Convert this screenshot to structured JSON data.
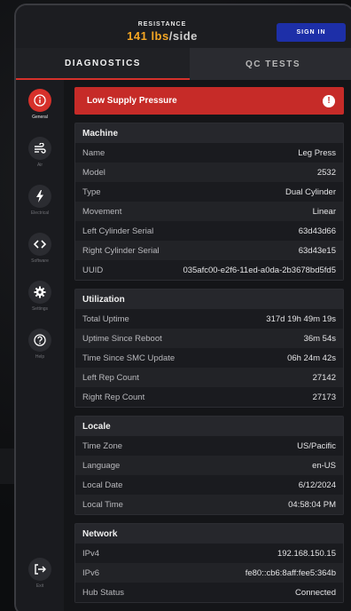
{
  "header": {
    "resistance_label": "RESISTANCE",
    "resistance_value": "141 lbs",
    "resistance_unit": "/side",
    "sign_in_label": "SIGN IN"
  },
  "tabs": [
    {
      "label": "DIAGNOSTICS",
      "active": true
    },
    {
      "label": "QC TESTS",
      "active": false
    }
  ],
  "sidebar": {
    "items": [
      {
        "label": "General",
        "icon": "info-icon",
        "active": true
      },
      {
        "label": "Air",
        "icon": "air-icon",
        "active": false
      },
      {
        "label": "Electrical",
        "icon": "bolt-icon",
        "active": false
      },
      {
        "label": "Software",
        "icon": "code-icon",
        "active": false
      },
      {
        "label": "Settings",
        "icon": "gear-icon",
        "active": false
      },
      {
        "label": "Help",
        "icon": "help-icon",
        "active": false
      }
    ],
    "exit": {
      "label": "Exit",
      "icon": "exit-icon"
    }
  },
  "alert": {
    "text": "Low Supply Pressure",
    "icon": "exclamation-icon",
    "color": "#c62b28"
  },
  "sections": {
    "machine": {
      "title": "Machine",
      "rows": [
        {
          "key": "Name",
          "value": "Leg Press"
        },
        {
          "key": "Model",
          "value": "2532"
        },
        {
          "key": "Type",
          "value": "Dual Cylinder"
        },
        {
          "key": "Movement",
          "value": "Linear"
        },
        {
          "key": "Left Cylinder Serial",
          "value": "63d43d66"
        },
        {
          "key": "Right Cylinder Serial",
          "value": "63d43e15"
        },
        {
          "key": "UUID",
          "value": "035afc00-e2f6-11ed-a0da-2b3678bd5fd5"
        }
      ]
    },
    "utilization": {
      "title": "Utilization",
      "rows": [
        {
          "key": "Total Uptime",
          "value": "317d 19h 49m 19s"
        },
        {
          "key": "Uptime Since Reboot",
          "value": "36m 54s"
        },
        {
          "key": "Time Since SMC Update",
          "value": "06h 24m 42s"
        },
        {
          "key": "Left Rep Count",
          "value": "27142"
        },
        {
          "key": "Right Rep Count",
          "value": "27173"
        }
      ]
    },
    "locale": {
      "title": "Locale",
      "rows": [
        {
          "key": "Time Zone",
          "value": "US/Pacific"
        },
        {
          "key": "Language",
          "value": "en-US"
        },
        {
          "key": "Local Date",
          "value": "6/12/2024"
        },
        {
          "key": "Local Time",
          "value": "04:58:04 PM"
        }
      ]
    },
    "network": {
      "title": "Network",
      "rows": [
        {
          "key": "IPv4",
          "value": "192.168.150.15"
        },
        {
          "key": "IPv6",
          "value": "fe80::cb6:8aff:fee5:364b"
        },
        {
          "key": "Hub Status",
          "value": "Connected"
        }
      ]
    }
  },
  "colors": {
    "accent_red": "#d6312b",
    "accent_orange": "#f5a623",
    "sign_in_blue": "#1d2fa8"
  }
}
